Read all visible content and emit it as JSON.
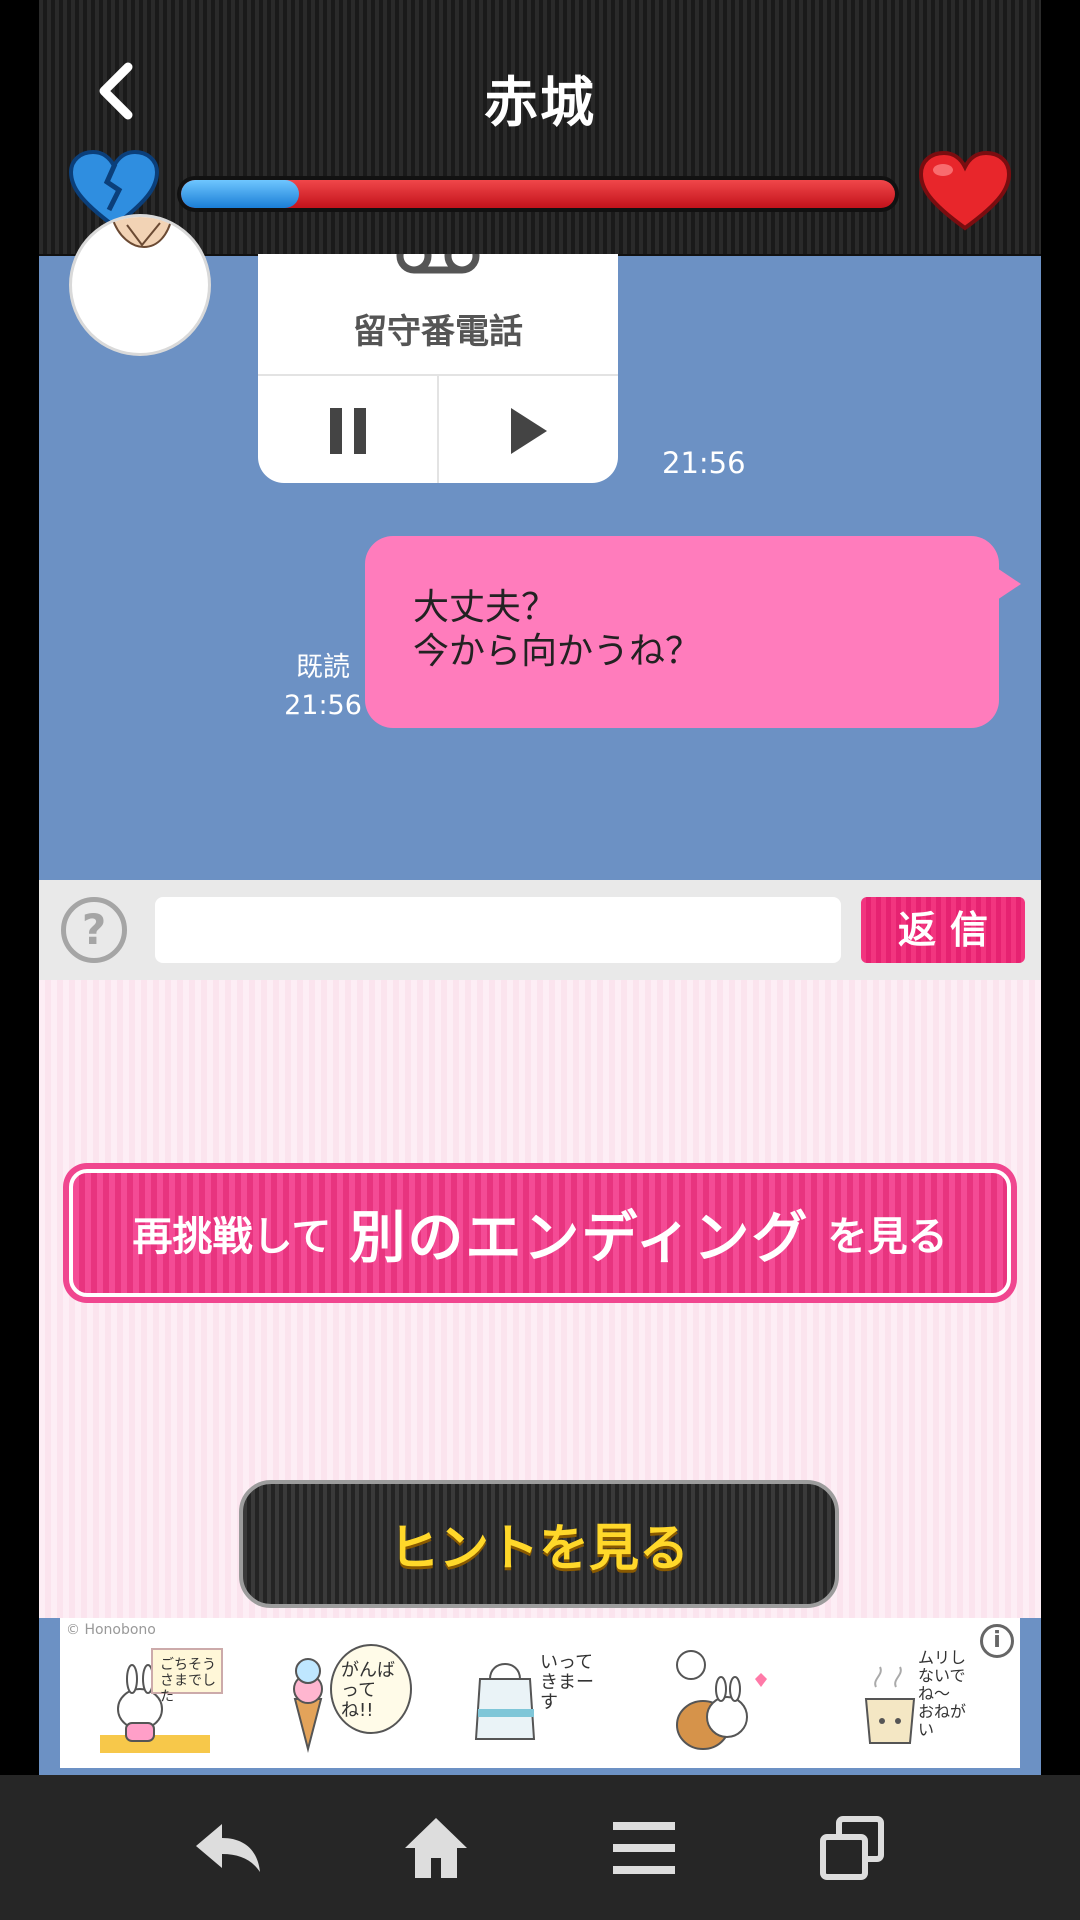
{
  "header": {
    "title": "赤城",
    "affection_fraction": 0.165
  },
  "voicemail": {
    "label": "留守番電話",
    "time": "21:56"
  },
  "sent_message": {
    "line1": "大丈夫？",
    "line2": "今から向かうね？",
    "read_label": "既読",
    "time": "21:56"
  },
  "input_bar": {
    "help_label": "?",
    "input_value": "",
    "reply_label": "返信"
  },
  "actions": {
    "retry_pre": "再挑戦して",
    "retry_main": "別のエンディング",
    "retry_post": "を見る",
    "hint_label": "ヒントを見る"
  },
  "ad": {
    "credit": "© Honobono",
    "info_label": "i",
    "sticker1_text": "ごちそうさまでした",
    "sticker2_text": "がんばってね!!",
    "sticker3_text": "いってきまーす",
    "sticker5_text": "ムリしないでね〜 おねがい"
  },
  "colors": {
    "chat_bg": "#6c91c4",
    "bubble_pink": "#ff7cbc",
    "accent_pink": "#f0468f",
    "hint_yellow": "#ffd82a",
    "meter_blue": "#1a7ed6",
    "meter_red": "#c3121b"
  }
}
